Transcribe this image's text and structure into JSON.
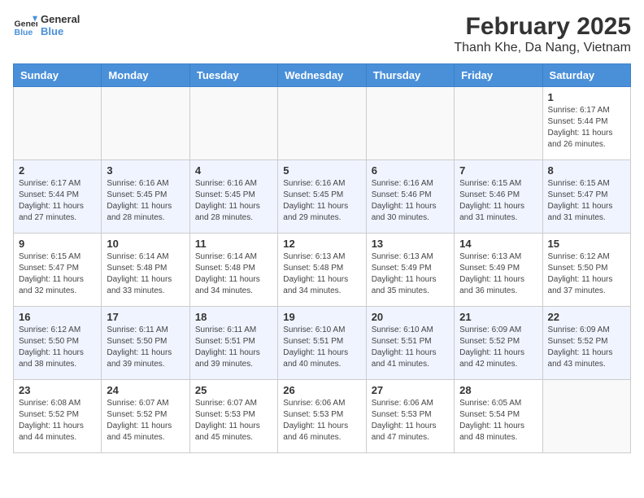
{
  "header": {
    "logo_line1": "General",
    "logo_line2": "Blue",
    "month_year": "February 2025",
    "location": "Thanh Khe, Da Nang, Vietnam"
  },
  "weekdays": [
    "Sunday",
    "Monday",
    "Tuesday",
    "Wednesday",
    "Thursday",
    "Friday",
    "Saturday"
  ],
  "weeks": [
    [
      {
        "day": "",
        "info": ""
      },
      {
        "day": "",
        "info": ""
      },
      {
        "day": "",
        "info": ""
      },
      {
        "day": "",
        "info": ""
      },
      {
        "day": "",
        "info": ""
      },
      {
        "day": "",
        "info": ""
      },
      {
        "day": "1",
        "info": "Sunrise: 6:17 AM\nSunset: 5:44 PM\nDaylight: 11 hours and 26 minutes."
      }
    ],
    [
      {
        "day": "2",
        "info": "Sunrise: 6:17 AM\nSunset: 5:44 PM\nDaylight: 11 hours and 27 minutes."
      },
      {
        "day": "3",
        "info": "Sunrise: 6:16 AM\nSunset: 5:45 PM\nDaylight: 11 hours and 28 minutes."
      },
      {
        "day": "4",
        "info": "Sunrise: 6:16 AM\nSunset: 5:45 PM\nDaylight: 11 hours and 28 minutes."
      },
      {
        "day": "5",
        "info": "Sunrise: 6:16 AM\nSunset: 5:45 PM\nDaylight: 11 hours and 29 minutes."
      },
      {
        "day": "6",
        "info": "Sunrise: 6:16 AM\nSunset: 5:46 PM\nDaylight: 11 hours and 30 minutes."
      },
      {
        "day": "7",
        "info": "Sunrise: 6:15 AM\nSunset: 5:46 PM\nDaylight: 11 hours and 31 minutes."
      },
      {
        "day": "8",
        "info": "Sunrise: 6:15 AM\nSunset: 5:47 PM\nDaylight: 11 hours and 31 minutes."
      }
    ],
    [
      {
        "day": "9",
        "info": "Sunrise: 6:15 AM\nSunset: 5:47 PM\nDaylight: 11 hours and 32 minutes."
      },
      {
        "day": "10",
        "info": "Sunrise: 6:14 AM\nSunset: 5:48 PM\nDaylight: 11 hours and 33 minutes."
      },
      {
        "day": "11",
        "info": "Sunrise: 6:14 AM\nSunset: 5:48 PM\nDaylight: 11 hours and 34 minutes."
      },
      {
        "day": "12",
        "info": "Sunrise: 6:13 AM\nSunset: 5:48 PM\nDaylight: 11 hours and 34 minutes."
      },
      {
        "day": "13",
        "info": "Sunrise: 6:13 AM\nSunset: 5:49 PM\nDaylight: 11 hours and 35 minutes."
      },
      {
        "day": "14",
        "info": "Sunrise: 6:13 AM\nSunset: 5:49 PM\nDaylight: 11 hours and 36 minutes."
      },
      {
        "day": "15",
        "info": "Sunrise: 6:12 AM\nSunset: 5:50 PM\nDaylight: 11 hours and 37 minutes."
      }
    ],
    [
      {
        "day": "16",
        "info": "Sunrise: 6:12 AM\nSunset: 5:50 PM\nDaylight: 11 hours and 38 minutes."
      },
      {
        "day": "17",
        "info": "Sunrise: 6:11 AM\nSunset: 5:50 PM\nDaylight: 11 hours and 39 minutes."
      },
      {
        "day": "18",
        "info": "Sunrise: 6:11 AM\nSunset: 5:51 PM\nDaylight: 11 hours and 39 minutes."
      },
      {
        "day": "19",
        "info": "Sunrise: 6:10 AM\nSunset: 5:51 PM\nDaylight: 11 hours and 40 minutes."
      },
      {
        "day": "20",
        "info": "Sunrise: 6:10 AM\nSunset: 5:51 PM\nDaylight: 11 hours and 41 minutes."
      },
      {
        "day": "21",
        "info": "Sunrise: 6:09 AM\nSunset: 5:52 PM\nDaylight: 11 hours and 42 minutes."
      },
      {
        "day": "22",
        "info": "Sunrise: 6:09 AM\nSunset: 5:52 PM\nDaylight: 11 hours and 43 minutes."
      }
    ],
    [
      {
        "day": "23",
        "info": "Sunrise: 6:08 AM\nSunset: 5:52 PM\nDaylight: 11 hours and 44 minutes."
      },
      {
        "day": "24",
        "info": "Sunrise: 6:07 AM\nSunset: 5:52 PM\nDaylight: 11 hours and 45 minutes."
      },
      {
        "day": "25",
        "info": "Sunrise: 6:07 AM\nSunset: 5:53 PM\nDaylight: 11 hours and 45 minutes."
      },
      {
        "day": "26",
        "info": "Sunrise: 6:06 AM\nSunset: 5:53 PM\nDaylight: 11 hours and 46 minutes."
      },
      {
        "day": "27",
        "info": "Sunrise: 6:06 AM\nSunset: 5:53 PM\nDaylight: 11 hours and 47 minutes."
      },
      {
        "day": "28",
        "info": "Sunrise: 6:05 AM\nSunset: 5:54 PM\nDaylight: 11 hours and 48 minutes."
      },
      {
        "day": "",
        "info": ""
      }
    ]
  ]
}
